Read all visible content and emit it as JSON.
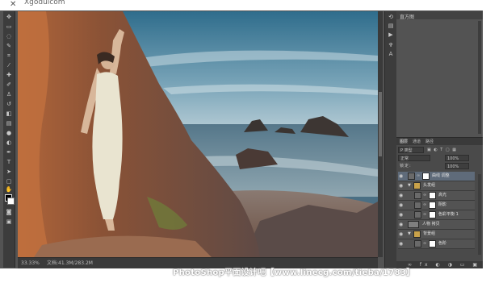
{
  "browser": {
    "close_glyph": "✕",
    "title": "Xgoduicom"
  },
  "statusbar": {
    "zoom": "33.33%",
    "doc": "文档:41.3M/283.2M"
  },
  "panel_top": {
    "label": "直方图"
  },
  "layers_panel": {
    "tabs": [
      "图层",
      "通道",
      "路径"
    ],
    "kind_label": "P 类型",
    "blend_mode": "正常",
    "opacity": "100%",
    "lock_label": "锁定:",
    "fill": "100%",
    "rows": [
      {
        "name": "曲线 调整",
        "indent": 0,
        "type": "adjust",
        "selected": true
      },
      {
        "name": "头发组",
        "indent": 1,
        "type": "group",
        "selected": false
      },
      {
        "name": "高光",
        "indent": 2,
        "type": "mask",
        "selected": false
      },
      {
        "name": "阴影",
        "indent": 2,
        "type": "mask",
        "selected": false
      },
      {
        "name": "色彩平衡 1",
        "indent": 2,
        "type": "mask",
        "selected": false
      },
      {
        "name": "人物 拷贝",
        "indent": 1,
        "type": "photo",
        "selected": false
      },
      {
        "name": "背景组",
        "indent": 1,
        "type": "group",
        "selected": false
      },
      {
        "name": "色阶",
        "indent": 2,
        "type": "mask",
        "selected": false
      }
    ]
  },
  "footer": {
    "watermark": "PhotoShop平面设计吧【www.linecg.com/tieba/1783】"
  }
}
